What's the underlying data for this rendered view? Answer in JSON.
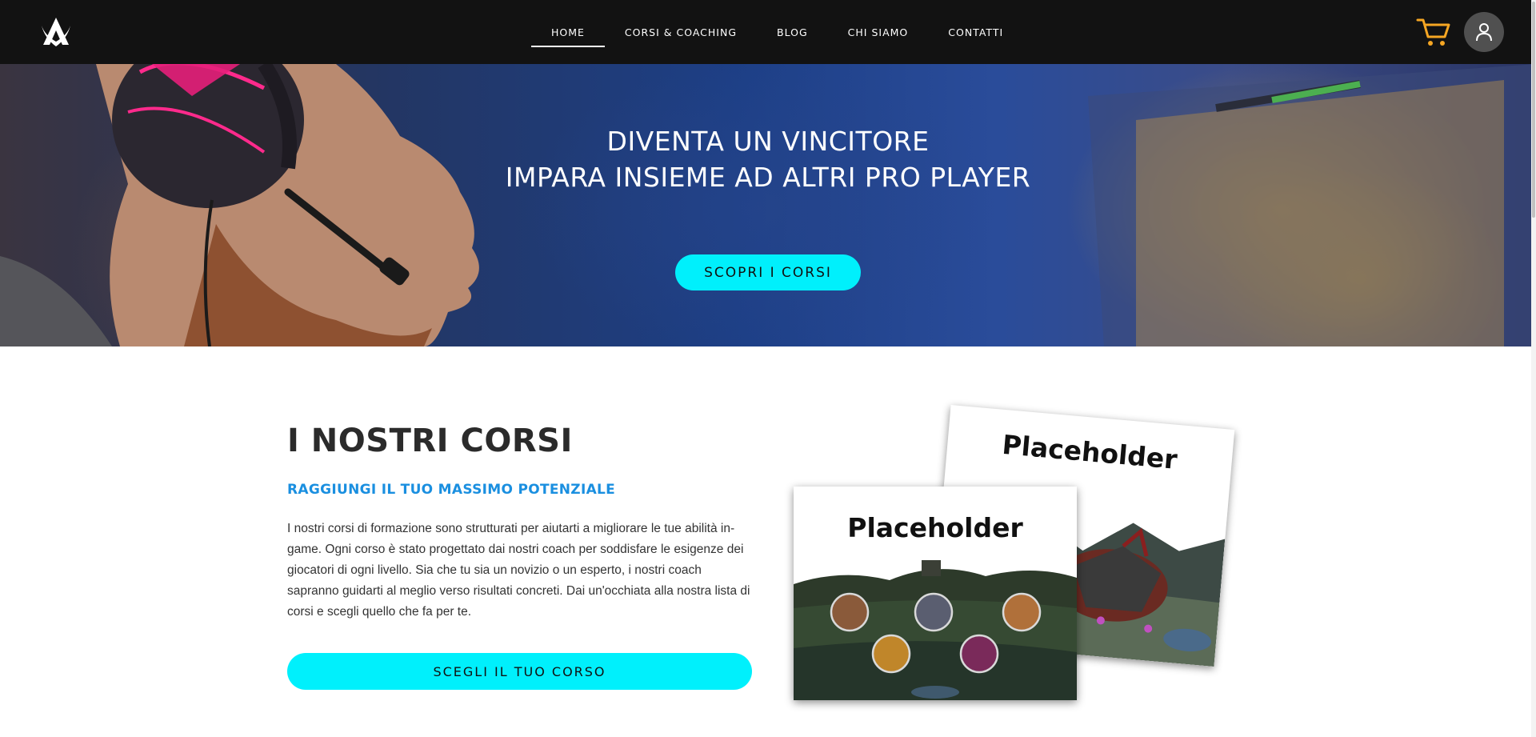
{
  "header": {
    "nav": [
      {
        "label": "HOME",
        "active": true
      },
      {
        "label": "CORSI & COACHING",
        "active": false
      },
      {
        "label": "BLOG",
        "active": false
      },
      {
        "label": "CHI SIAMO",
        "active": false
      },
      {
        "label": "CONTATTI",
        "active": false
      }
    ],
    "icons": {
      "logo": "logo-icon",
      "cart": "cart-icon",
      "user": "user-icon"
    },
    "colors": {
      "background": "#121212",
      "cart": "#f5a623",
      "user_button": "#505050"
    }
  },
  "hero": {
    "title_line1": "DIVENTA UN VINCITORE",
    "title_line2": "IMPARA INSIEME AD ALTRI PRO PLAYER",
    "cta_label": "SCOPRI I CORSI"
  },
  "courses": {
    "title": "I NOSTRI CORSI",
    "subtitle": "RAGGIUNGI IL TUO MASSIMO POTENZIALE",
    "body": "I nostri corsi di formazione sono strutturati per aiutarti a migliorare le tue abilità in-game. Ogni corso è stato progettato dai nostri coach per soddisfare le esigenze dei giocatori di ogni livello. Sia che tu sia un novizio o un esperto, i nostri coach sapranno guidarti al meglio verso risultati concreti. Dai un'occhiata alla nostra lista di corsi e scegli quello che fa per te.",
    "cta_label": "SCEGLI IL TUO CORSO",
    "cards": [
      {
        "title": "Placeholder"
      },
      {
        "title": "Placeholder"
      }
    ]
  },
  "colors": {
    "accent": "#00f0fc",
    "subtitle": "#1a8fe0"
  }
}
